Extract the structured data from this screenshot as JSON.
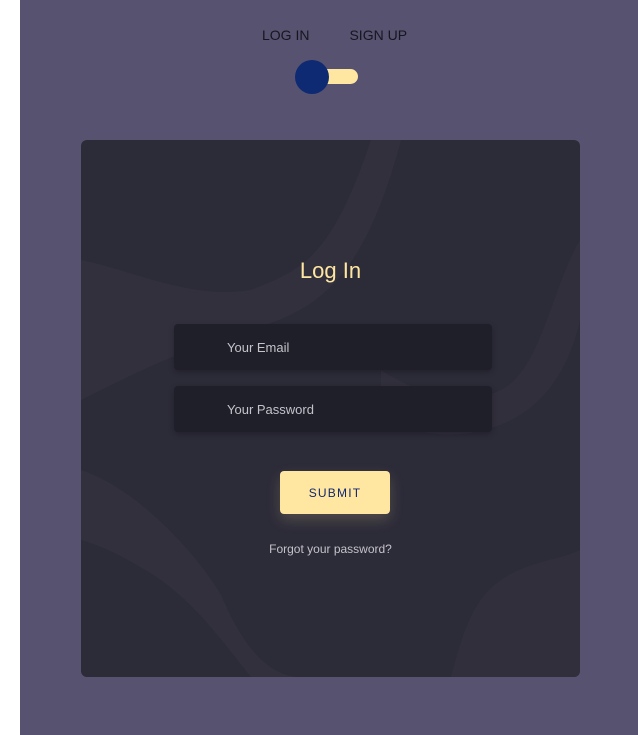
{
  "switch": {
    "login_label": "LOG IN",
    "signup_label": "SIGN UP"
  },
  "form": {
    "title": "Log In",
    "email_placeholder": "Your Email",
    "password_placeholder": "Your Password",
    "submit_label": "SUBMIT",
    "forgot_link": "Forgot your password?"
  },
  "colors": {
    "background": "#565270",
    "card": "#2c2b38",
    "accent": "#ffe6a1",
    "knob": "#0d2a73"
  }
}
